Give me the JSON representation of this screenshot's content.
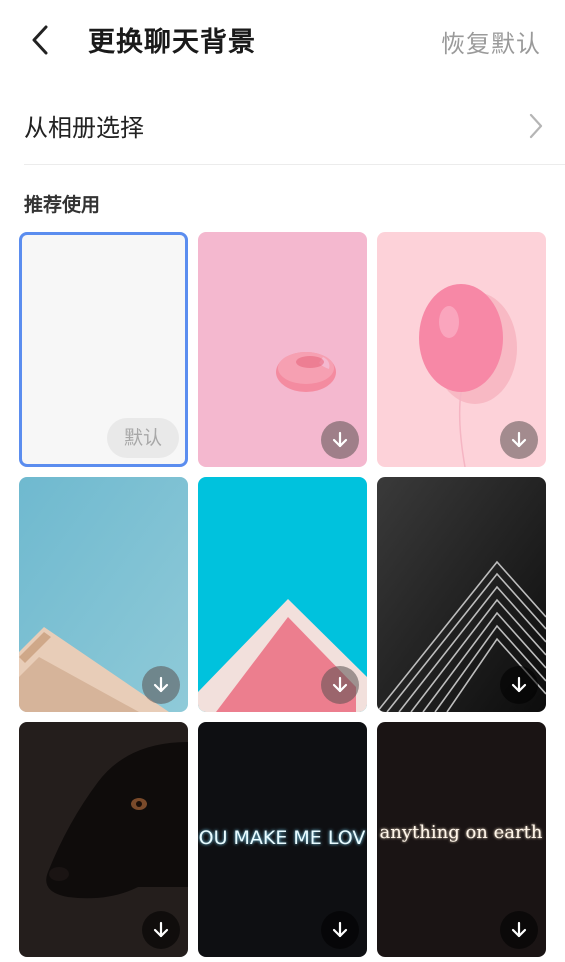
{
  "header": {
    "title": "更换聊天背景",
    "restore_label": "恢复默认"
  },
  "album": {
    "label": "从相册选择"
  },
  "section": {
    "title": "推荐使用"
  },
  "tiles": [
    {
      "name": "white-default",
      "selected": true,
      "badge": "默认"
    },
    {
      "name": "pink-macaron"
    },
    {
      "name": "pink-balloon"
    },
    {
      "name": "sky-building"
    },
    {
      "name": "cyan-pink-roof"
    },
    {
      "name": "dark-lines"
    },
    {
      "name": "black-dog"
    },
    {
      "name": "neon-you-make-me-love",
      "text": "OU MAKE ME LOV"
    },
    {
      "name": "neon-anything-on-earth",
      "text": "anything on earth"
    }
  ],
  "colors": {
    "accent": "#5b8def",
    "restore_text": "#9a9a9a"
  }
}
